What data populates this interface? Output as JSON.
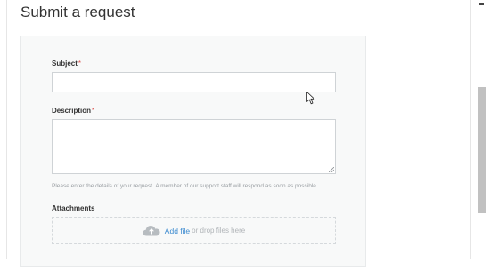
{
  "page": {
    "title": "Submit a request"
  },
  "form": {
    "subject": {
      "label": "Subject",
      "required_marker": "*",
      "value": ""
    },
    "description": {
      "label": "Description",
      "required_marker": "*",
      "value": "",
      "hint": "Please enter the details of your request. A member of our support staff will respond as soon as possible."
    },
    "attachments": {
      "label": "Attachments",
      "add_file_label": "Add file",
      "drop_text": "or drop files here",
      "icon": "cloud-upload-icon"
    }
  },
  "colors": {
    "link": "#3d8bd0",
    "required": "#d9534f",
    "panel_background": "#f8f9f9",
    "scrollbar_thumb": "#c1c1c1"
  }
}
